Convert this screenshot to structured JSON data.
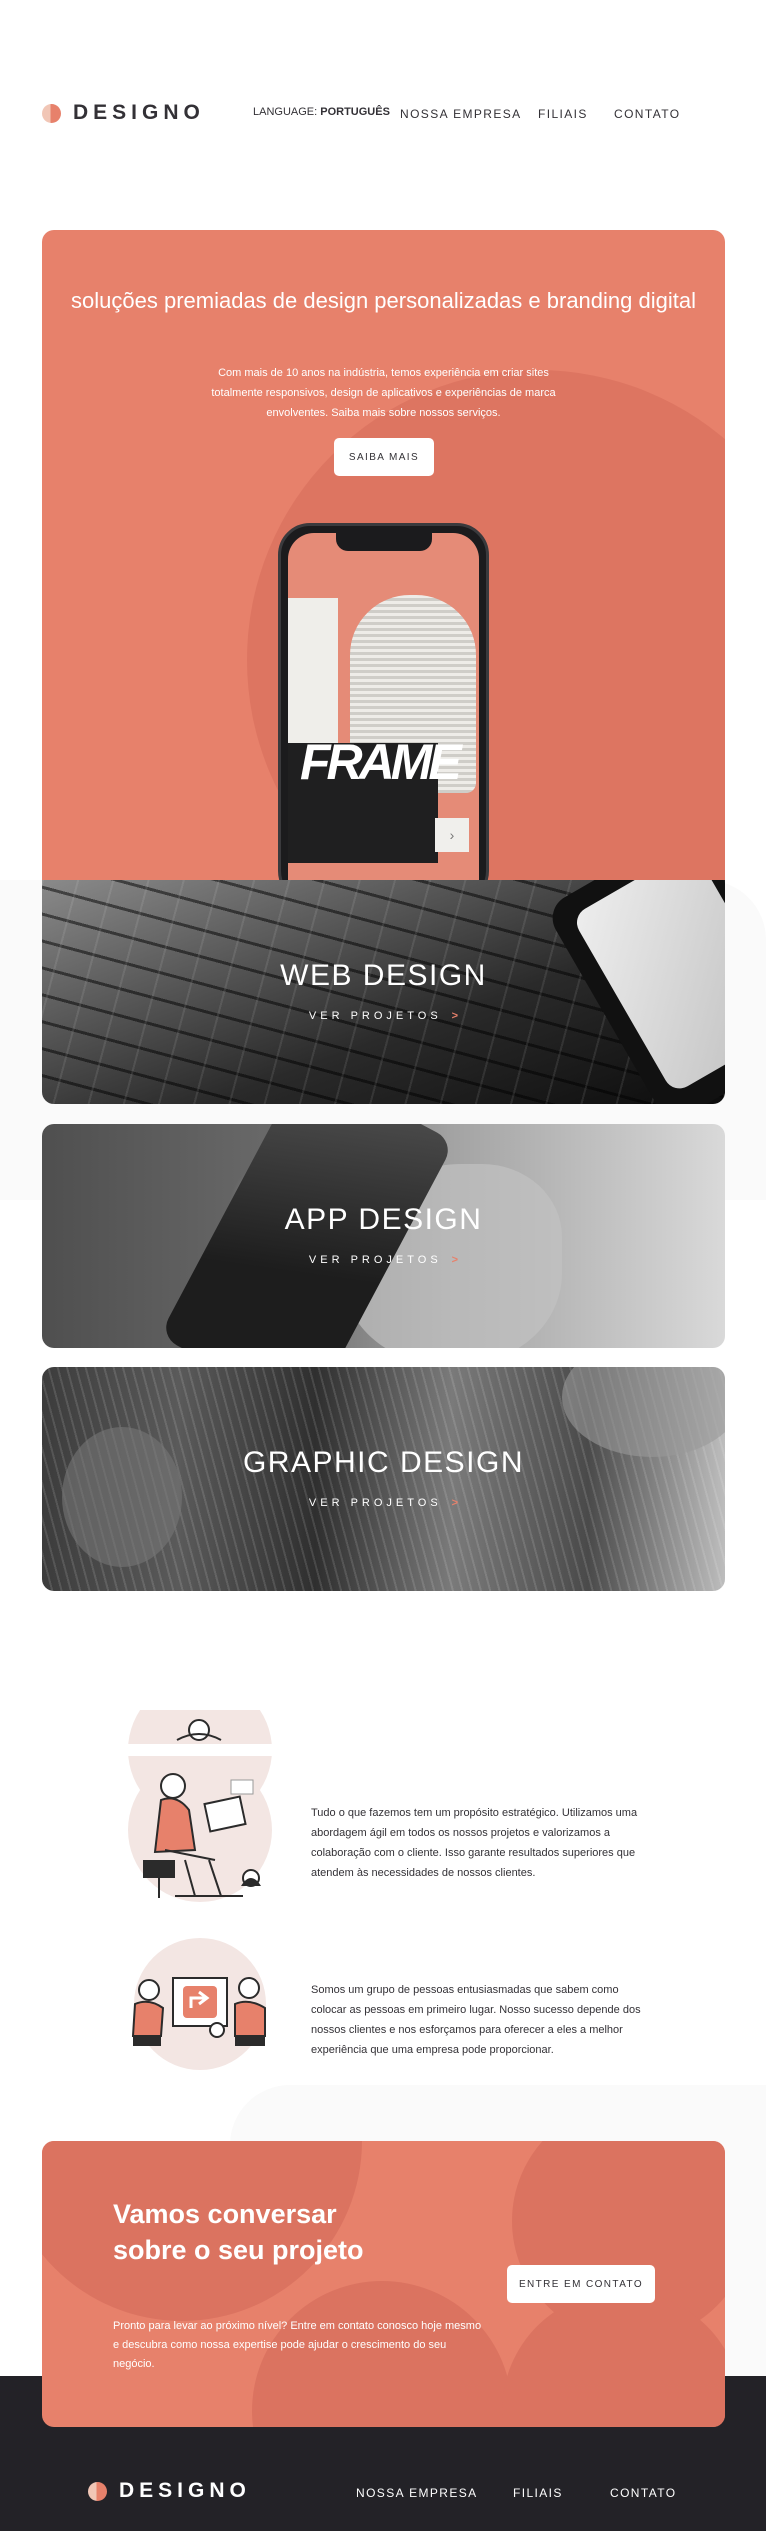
{
  "header": {
    "logo_text": "DESIGNO",
    "language_label": "LANGUAGE:",
    "language_value": "PORTUGUÊS",
    "nav": [
      "NOSSA EMPRESA",
      "FILIAIS",
      "CONTATO"
    ]
  },
  "hero": {
    "title": "soluções premiadas de design personalizadas e branding digital",
    "text": "Com mais de 10 anos na indústria, temos experiência em criar sites totalmente responsivos, design de aplicativos e experiências de marca envolventes. Saiba mais sobre nossos serviços.",
    "button": "SAIBA MAIS",
    "phone_text": "FRAME",
    "phone_arrow": "›"
  },
  "services": [
    {
      "title": "WEB DESIGN",
      "link": "VER PROJETOS",
      "chevron": ">"
    },
    {
      "title": "APP DESIGN",
      "link": "VER PROJETOS",
      "chevron": ">"
    },
    {
      "title": "GRAPHIC DESIGN",
      "link": "VER PROJETOS",
      "chevron": ">"
    }
  ],
  "features": [
    {
      "text": "Tudo o que fazemos tem um propósito estratégico. Utilizamos uma abordagem ágil em todos os nossos projetos e valorizamos a colaboração com o cliente. Isso garante resultados superiores que atendem às necessidades de nossos clientes."
    },
    {
      "text": "Somos um grupo de pessoas entusiasmadas que sabem como colocar as pessoas em primeiro lugar. Nosso sucesso depende dos nossos clientes e nos esforçamos para oferecer a eles a melhor experiência que uma empresa pode proporcionar."
    }
  ],
  "cta": {
    "title": "Vamos conversar sobre o seu projeto",
    "text": "Pronto para levar ao próximo nível? Entre em contato conosco hoje mesmo e descubra como nossa expertise pode ajudar o crescimento do seu negócio.",
    "button": "ENTRE EM CONTATO"
  },
  "footer": {
    "logo_text": "DESIGNO",
    "nav": [
      "NOSSA EMPRESA",
      "FILIAIS",
      "CONTATO"
    ]
  },
  "colors": {
    "accent": "#e7816b",
    "accent_dark": "#db7360",
    "dark": "#232227",
    "text": "#333136"
  }
}
